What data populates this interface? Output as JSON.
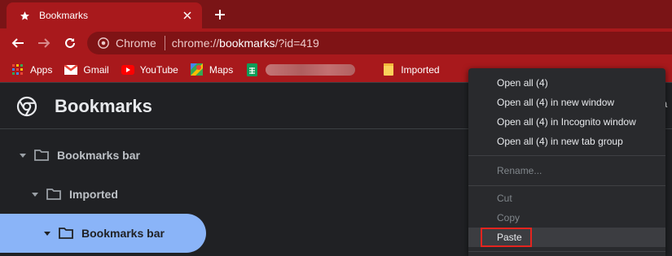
{
  "tab": {
    "title": "Bookmarks",
    "icon": "star-icon"
  },
  "toolbar": {
    "site_chip": "Chrome",
    "url_scheme": "chrome://",
    "url_host": "bookmarks",
    "url_rest": "/?id=419"
  },
  "bookmarks_bar": {
    "items": [
      {
        "label": "Apps",
        "icon": "apps-grid-icon"
      },
      {
        "label": "Gmail",
        "icon": "gmail-icon"
      },
      {
        "label": "YouTube",
        "icon": "youtube-icon"
      },
      {
        "label": "Maps",
        "icon": "maps-icon"
      },
      {
        "label": "",
        "icon": "google-sheets-icon"
      },
      {
        "label": "Imported",
        "icon": "folder-icon"
      }
    ]
  },
  "page": {
    "title": "Bookmarks"
  },
  "tree": {
    "nodes": [
      {
        "label": "Bookmarks bar",
        "level": 0
      },
      {
        "label": "Imported",
        "level": 1
      },
      {
        "label": "Bookmarks bar",
        "level": 2,
        "selected": true
      }
    ]
  },
  "context_menu": {
    "group1": [
      "Open all (4)",
      "Open all (4) in new window",
      "Open all (4) in Incognito window",
      "Open all (4) in new tab group"
    ],
    "rename": "Rename...",
    "cut": "Cut",
    "copy": "Copy",
    "paste": "Paste"
  },
  "colors": {
    "tab_strip": "#7a1416",
    "toolbar": "#a8191c",
    "selected_node": "#8ab4f8",
    "highlight_box": "#e4241f"
  }
}
